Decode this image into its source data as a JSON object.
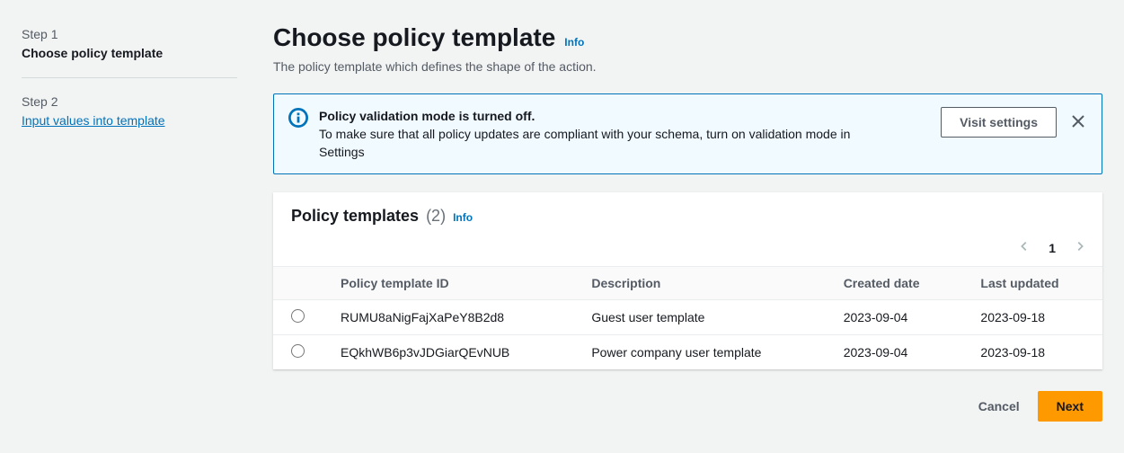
{
  "steps": {
    "step1_label": "Step 1",
    "step1_title": "Choose policy template",
    "step2_label": "Step 2",
    "step2_title": "Input values into template"
  },
  "header": {
    "title": "Choose policy template",
    "info": "Info",
    "description": "The policy template which defines the shape of the action."
  },
  "alert": {
    "title": "Policy validation mode is turned off.",
    "body": "To make sure that all policy updates are compliant with your schema, turn on validation mode in Settings",
    "action": "Visit settings"
  },
  "templates_panel": {
    "title": "Policy templates",
    "count": "(2)",
    "info": "Info",
    "page": "1",
    "columns": {
      "id": "Policy template ID",
      "description": "Description",
      "created": "Created date",
      "updated": "Last updated"
    },
    "rows": [
      {
        "id": "RUMU8aNigFajXaPeY8B2d8",
        "description": "Guest user template",
        "created": "2023-09-04",
        "updated": "2023-09-18"
      },
      {
        "id": "EQkhWB6p3vJDGiarQEvNUB",
        "description": "Power company user template",
        "created": "2023-09-04",
        "updated": "2023-09-18"
      }
    ]
  },
  "footer": {
    "cancel": "Cancel",
    "next": "Next"
  }
}
